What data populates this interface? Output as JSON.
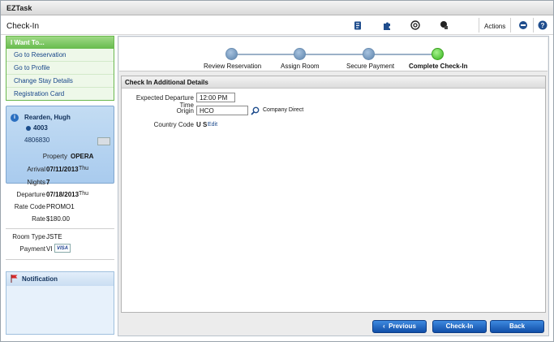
{
  "app": {
    "title": "EZTask"
  },
  "header": {
    "page_title": "Check-In",
    "actions_label": "Actions"
  },
  "sidebar": {
    "want_title": "I Want To...",
    "want_items": [
      {
        "label": "Go to Reservation"
      },
      {
        "label": "Go to Profile"
      },
      {
        "label": "Change Stay Details"
      },
      {
        "label": "Registration Card"
      }
    ],
    "guest": {
      "name": "Rearden, Hugh",
      "room": "4003",
      "confirmation": "4806830"
    },
    "details": {
      "property_label": "Property",
      "property": "OPERA",
      "arrival_label": "Arrival",
      "arrival": "07/11/2013",
      "arrival_day": "Thu",
      "nights_label": "Nights",
      "nights": "7",
      "departure_label": "Departure",
      "departure": "07/18/2013",
      "departure_day": "Thu",
      "rate_code_label": "Rate Code",
      "rate_code": "PROMO1",
      "rate_label": "Rate",
      "rate": "$180.00",
      "room_type_label": "Room Type",
      "room_type": "JSTE",
      "payment_label": "Payment",
      "payment": "VI",
      "card_brand": "VISA"
    },
    "notification_title": "Notification"
  },
  "steps": [
    {
      "label": "Review Reservation",
      "state": "done"
    },
    {
      "label": "Assign Room",
      "state": "done"
    },
    {
      "label": "Secure Payment",
      "state": "done"
    },
    {
      "label": "Complete Check-In",
      "state": "active"
    }
  ],
  "form": {
    "section_title": "Check In Additional Details",
    "departure_time_label": "Expected Departure Time",
    "departure_time_value": "12:00 PM",
    "origin_label": "Origin",
    "origin_value": "HCO",
    "origin_description": "Company Direct",
    "country_label": "Country Code",
    "country_value": "U S",
    "edit_label": "Edit"
  },
  "buttons": {
    "previous": "Previous",
    "previous_arrow": "‹",
    "checkin": "Check-In",
    "back": "Back"
  },
  "colors": {
    "accent": "#1a5fbf",
    "want_green": "#66bb4d",
    "step_active": "#35b31c"
  }
}
